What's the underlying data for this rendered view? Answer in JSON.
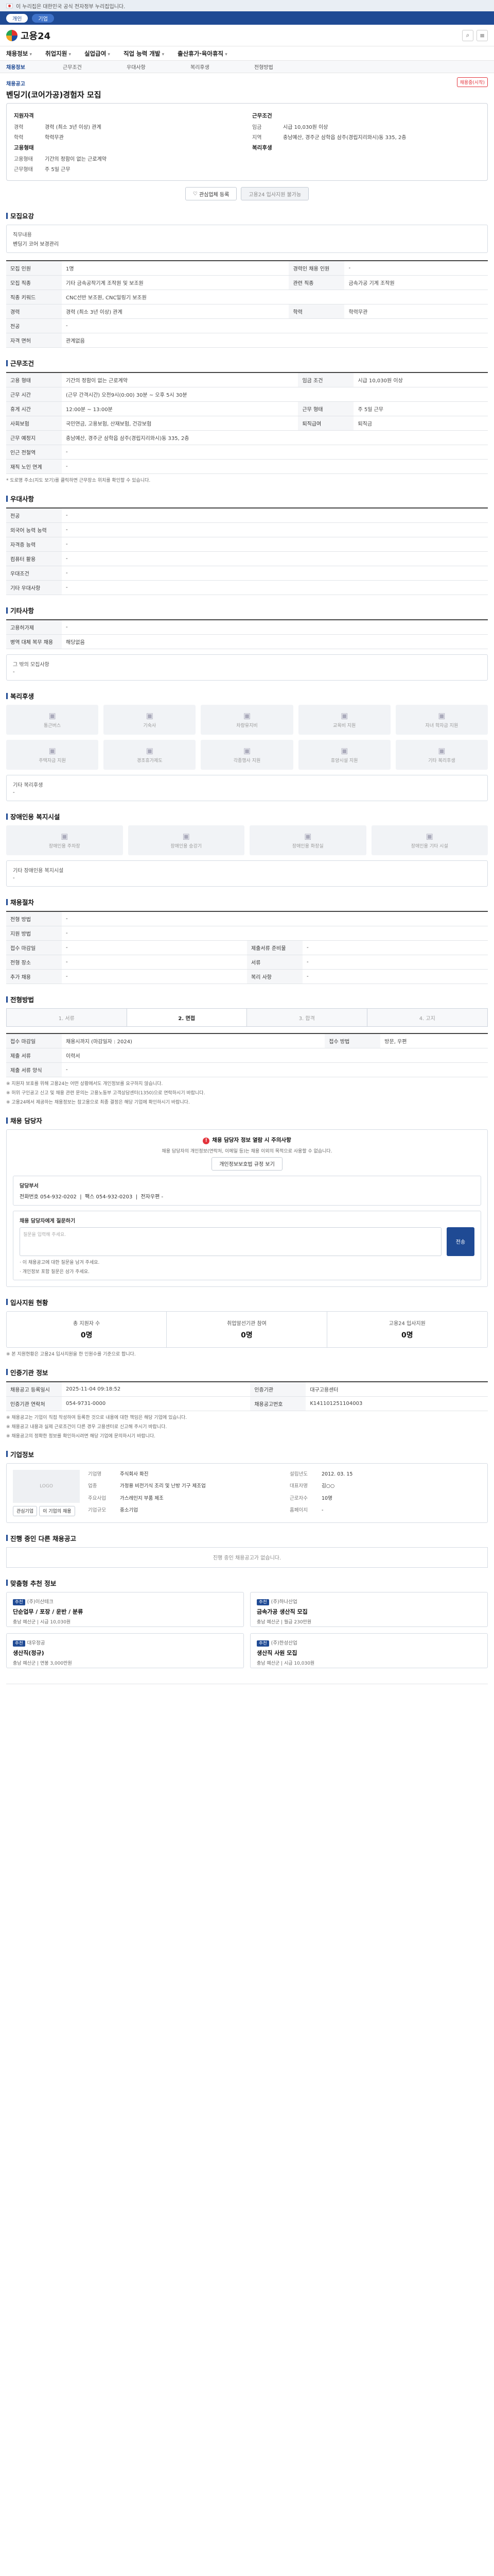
{
  "gov_banner": "이 누리집은 대한민국 공식 전자정부 누리집입니다.",
  "util": {
    "tabs": [
      "개인",
      "기업"
    ]
  },
  "brand": "고용24",
  "gnb": [
    "채용정보",
    "취업지원",
    "실업급여",
    "직업 능력 개발",
    "출산휴가·육아휴직"
  ],
  "lnb": [
    "채용정보",
    "근무조건",
    "우대사항",
    "복리후생",
    "전형방법"
  ],
  "job": {
    "crumb": "채용공고",
    "title": "벤딩기(코어가공)경험자 모집",
    "status": "채용중(시작)"
  },
  "summary": {
    "company_h": "지원자격",
    "condition_h": "근무조건",
    "left": [
      {
        "k": "경력",
        "v": "경력 (최소 3년 이상) 관계"
      },
      {
        "k": "학력",
        "v": "학력무관"
      }
    ],
    "right": [
      {
        "k": "임금",
        "v": "시급 10,030원 이상"
      },
      {
        "k": "지역",
        "v": "충남예산, 경주군 삼학읍 삼주(경립지리와시)동 335, 2층"
      }
    ],
    "type_h": "고용형태",
    "place_h": "복리후생",
    "left2": [
      {
        "k": "고용형태",
        "v": "기간의 정함이 없는 근로계약"
      },
      {
        "k": "근무형태",
        "v": "주 5일 근무"
      }
    ],
    "btn_apply": "관심업체 등록",
    "btn_doc": "고용24 입사지원 불가능"
  },
  "recruit": {
    "title": "모집요강",
    "rows": [
      [
        "직무내용",
        "벤딩기 코어 보경관리"
      ]
    ]
  },
  "recruit_table": [
    [
      "모집 인원",
      "1명",
      "경력인 채용 인원",
      "-"
    ],
    [
      "모집 직종",
      "기타 금속공작기계 조작원 및 보조원",
      "관련 직종",
      "금속가공 기계 조작원"
    ],
    [
      "직종 키워드",
      "CNC선반 보조원, CNC밀링기 보조원",
      "",
      ""
    ],
    [
      "경력",
      "경력 (최소 3년 이상) 관계",
      "학력",
      "학력무관"
    ],
    [
      "전공",
      "-",
      "",
      ""
    ],
    [
      "자격 면허",
      "관계없음",
      "",
      ""
    ]
  ],
  "work": {
    "title": "근무조건",
    "rows": [
      [
        "고용 형태",
        "기간의 정함이 없는 근로계약",
        "임금 조건",
        "시급 10,030원 이상"
      ],
      [
        "근무 시간",
        "(근무 간격시간)\n오전9시(0:00) 30분 ~ 오후 5시 30분",
        "",
        ""
      ],
      [
        "휴게 시간",
        "12:00분 ~ 13:00분",
        "근무 형태",
        "주 5일 근무"
      ],
      [
        "사회보험",
        "국민연금, 고용보험, 산재보험, 건강보험",
        "퇴직급여",
        "퇴직금"
      ],
      [
        "근무 예정지",
        "충남예산, 경주군 삼학읍 삼주(경립지리와시)동 335, 2층",
        "",
        ""
      ],
      [
        "인근 전철역",
        "-",
        "",
        ""
      ],
      [
        "재직 노인 연계",
        "-",
        "",
        ""
      ]
    ],
    "note": "* 도로명 주소(지도 보기)를 클릭하면 근무장소 위치를 확인할 수 있습니다."
  },
  "pref": {
    "title": "우대사항",
    "rows": [
      [
        "전공",
        "-"
      ],
      [
        "외국어 능력 능력",
        "-"
      ],
      [
        "자격증 능력",
        "-"
      ],
      [
        "컴퓨터 활용",
        "-"
      ],
      [
        "우대조건",
        "-"
      ],
      [
        "기타 우대사항",
        "-"
      ]
    ]
  },
  "other": {
    "title": "기타사항",
    "rows": [
      [
        "고용허가제",
        "-"
      ],
      [
        "병역 대체 복무 채용",
        "해당없음"
      ]
    ],
    "extra_label": "그 밖의 모집사항",
    "extra_value": "-"
  },
  "welfare": {
    "title": "복리후생",
    "icons": [
      "통근버스",
      "기숙사",
      "차량유지비",
      "교육비 지원",
      "자녀 학자금 지원",
      "주택자금 지원",
      "경조휴가제도",
      "각종행사 지원",
      "휴양시설 지원",
      "기타 복리후생"
    ],
    "extra_label": "기타 복리후생",
    "extra_value": "-"
  },
  "disabled": {
    "title": "장애인용 복지시설",
    "icons": [
      "장애인용 주차장",
      "장애인용 승강기",
      "장애인용 화장실",
      "장애인용 기타 시설"
    ],
    "extra_label": "기타 장애인용 복지시설",
    "extra_value": "-"
  },
  "hiring": {
    "title": "채용절차",
    "rows": [
      [
        "전형 방법",
        "-",
        "",
        ""
      ],
      [
        "지원 방법",
        "-",
        "",
        ""
      ],
      [
        "접수 마감일",
        "-",
        "제출서류 준비물",
        "-"
      ],
      [
        "전형 장소",
        "-",
        "서류",
        "-"
      ],
      [
        "추가 채용",
        "-",
        "복리 사항",
        "-"
      ]
    ]
  },
  "process": {
    "title": "전형방법",
    "steps": [
      "1. 서류",
      "2. 면접",
      "3. 합격",
      "4. 고지"
    ],
    "rows": [
      [
        "접수 마감일",
        "채용시까지 (마감일자 : 2024)",
        "접수 방법",
        "방문, 우편"
      ],
      [
        "",
        "",
        "제출 서류",
        "이력서"
      ],
      [
        "",
        "",
        "제출 서류 양식",
        "-"
      ]
    ],
    "notes": [
      "※ 지원자 보호를 위해 고용24는 어떤 상황에서도 개인정보를 요구하지 않습니다.",
      "※ 허위 구인공고 신고 및 채용 관련 문의는 고용노동부 고객상담센터(1350)으로 연락하시기 바랍니다.",
      "※ 고용24에서 제공하는 채용정보는 참고용으로 최종 결정은 해당 기업에 확인하시기 바랍니다."
    ]
  },
  "contact": {
    "title": "채용 담당자",
    "warn": "채용 담당자 정보 열람 시 주의사항",
    "desc": "채용 담당자의 개인정보(연락처, 이메일 등)는 채용 이외의 목적으로 사용할 수 없습니다.",
    "btn": "개인정보보호법 규정 보기",
    "info_h": "담당부서",
    "phone_k": "전화번호",
    "phone": "054-932-0202",
    "fax_k": "팩스",
    "fax": "054-932-0203",
    "email_k": "전자우편",
    "email": "-",
    "qa_h": "채용 담당자에게 질문하기",
    "qa_ph": "질문을 입력해 주세요.",
    "qa_btn": "전송",
    "qa_notes": [
      "· 이 채용공고에 대한 질문을 남겨 주세요.",
      "· 개인정보 포함 질문은 삼가 주세요."
    ]
  },
  "apply_stats": {
    "title": "입사지원 현황",
    "cols": [
      {
        "k": "총 지원자 수",
        "v": "0명"
      },
      {
        "k": "취업알선기관 참여",
        "v": "0명"
      },
      {
        "k": "고용24 입사지원",
        "v": "0명"
      }
    ],
    "note": "※ 본 지원현황은 고용24 입사지원을 한 인원수를 기준으로 합니다."
  },
  "manage": {
    "title": "인증기관 정보",
    "rows": [
      [
        "채용공고 등록일시",
        "2025-11-04 09:18:52",
        "인증기관",
        "대구고용센터"
      ],
      [
        "인증기관 연락처",
        "054-9731-0000",
        "채용공고번호",
        "K141101251104003"
      ]
    ],
    "notes": [
      "※ 채용공고는 기업이 직접 작성하여 등록한 것으로 내용에 대한 책임은 해당 기업에 있습니다.",
      "※ 채용공고 내용과 실제 근로조건이 다른 경우 고용센터로 신고해 주시기 바랍니다.",
      "※ 채용공고의 정확한 정보를 확인하시려면 해당 기업에 문의하시기 바랍니다."
    ]
  },
  "corp": {
    "title": "기업정보",
    "logo": "LOGO",
    "fields": [
      [
        "기업명",
        "주식회사 화진"
      ],
      [
        "설립년도",
        "2012. 03. 15"
      ],
      [
        "업종",
        "가정용 비전기식 조리 및 난방 기구 제조업"
      ],
      [
        "대표자명",
        "김○○"
      ],
      [
        "주요사업",
        "가스레인지 부품 제조"
      ],
      [
        "근로자수",
        "10명"
      ],
      [
        "기업규모",
        "중소기업"
      ],
      [
        "홈페이지",
        "-"
      ]
    ],
    "btns": [
      "관심기업",
      "이 기업의 채용"
    ]
  },
  "others": {
    "title": "진행 중인 다른 채용공고",
    "empty": "진행 중인 채용공고가 없습니다."
  },
  "recs": {
    "title": "맞춤형 추천 정보",
    "items": [
      {
        "cat": "추천",
        "comp": "(주)이산테크",
        "title": "단순업무 / 포장 / 운반 / 분류",
        "loc": "충남 예산군",
        "pay": "시급 10,030원"
      },
      {
        "cat": "추천",
        "comp": "(주)하나산업",
        "title": "금속가공 생산직 모집",
        "loc": "충남 예산군",
        "pay": "월급 230만원"
      },
      {
        "cat": "추천",
        "comp": "대우정공",
        "title": "생산직(정규)",
        "loc": "충남 예산군",
        "pay": "연봉 3,000만원"
      },
      {
        "cat": "추천",
        "comp": "(주)한성산업",
        "title": "생산직 사원 모집",
        "loc": "충남 예산군",
        "pay": "시급 10,030원"
      }
    ]
  }
}
